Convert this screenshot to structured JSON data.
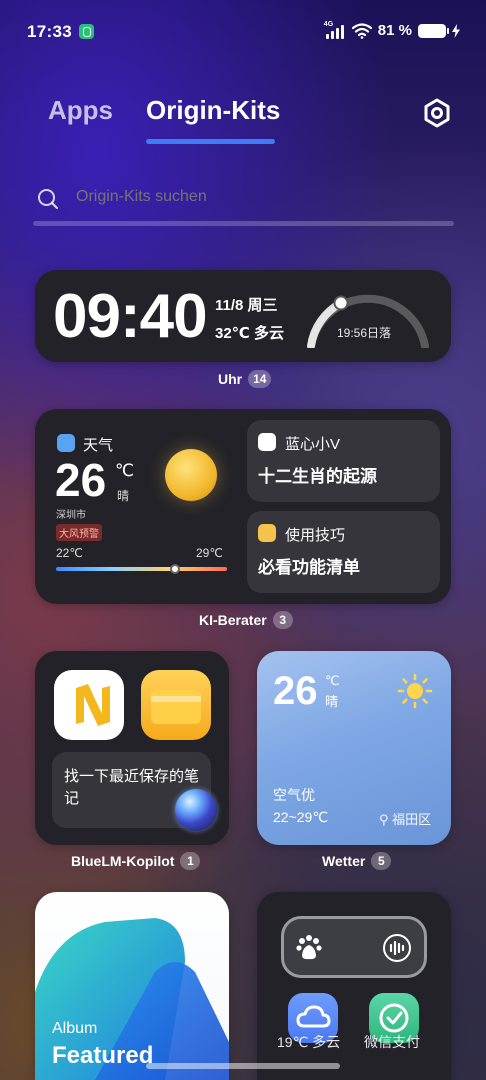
{
  "status_bar": {
    "time": "17:33",
    "network": "4G",
    "battery": "81 %"
  },
  "tabs": [
    {
      "label": "Apps"
    },
    {
      "label": "Origin-Kits"
    }
  ],
  "search": {
    "placeholder": "Origin-Kits suchen"
  },
  "clock_widget": {
    "time": "09:40",
    "date": "11/8 周三",
    "weather": "32℃ 多云",
    "sunset": "19:56日落",
    "caption": "Uhr",
    "count": "14"
  },
  "ai_widget": {
    "weather_title": "天气",
    "temp": "26",
    "unit": "℃",
    "condition": "晴",
    "city": "深圳市",
    "warning": "大风预警",
    "low": "22℃",
    "high": "29℃",
    "card1_title": "蓝心小V",
    "card1_text": "十二生肖的起源",
    "card2_title": "使用技巧",
    "card2_text": "必看功能清单",
    "caption": "KI-Berater",
    "count": "3"
  },
  "bluelm_widget": {
    "bubble": "找一下最近保存的笔记",
    "caption": "BlueLM-Kopilot",
    "count": "1"
  },
  "weather_widget": {
    "temp": "26",
    "unit": "℃",
    "condition": "晴",
    "air": "空气优",
    "range": "22~29℃",
    "location": "福田区",
    "caption": "Wetter",
    "count": "5"
  },
  "album_widget": {
    "label": "Album",
    "title": "Featured"
  },
  "quick_widget": {
    "label1": "19℃ 多云",
    "label2": "微信支付"
  },
  "colors": {
    "accent": "#3e7bf5",
    "card": "#222228",
    "subcard": "#35353b"
  }
}
